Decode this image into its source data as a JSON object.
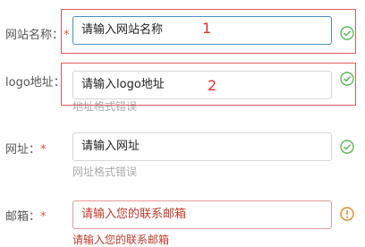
{
  "form": {
    "fields": [
      {
        "label": "网站名称：",
        "required_mark": "*",
        "placeholder": "请输入网站名称",
        "status": "valid",
        "annotation_number": "1"
      },
      {
        "label": "logo地址：",
        "placeholder": "请输入logo地址",
        "hint": "地址格式错误",
        "status": "valid",
        "annotation_number": "2"
      },
      {
        "label": "网址：",
        "required_mark": "*",
        "placeholder": "请输入网址",
        "hint": "网址格式错误",
        "status": "valid"
      },
      {
        "label": "邮箱：",
        "required_mark": "*",
        "placeholder": "请输入您的联系邮箱",
        "error_message": "请输入您的联系邮箱",
        "status": "error"
      }
    ]
  },
  "colors": {
    "valid": "#5cb85c",
    "error": "#e08a2c",
    "required": "#d9534f",
    "annotation": "#e0302c"
  },
  "icons": {
    "valid": "check-circle-icon",
    "error": "exclamation-circle-icon"
  }
}
